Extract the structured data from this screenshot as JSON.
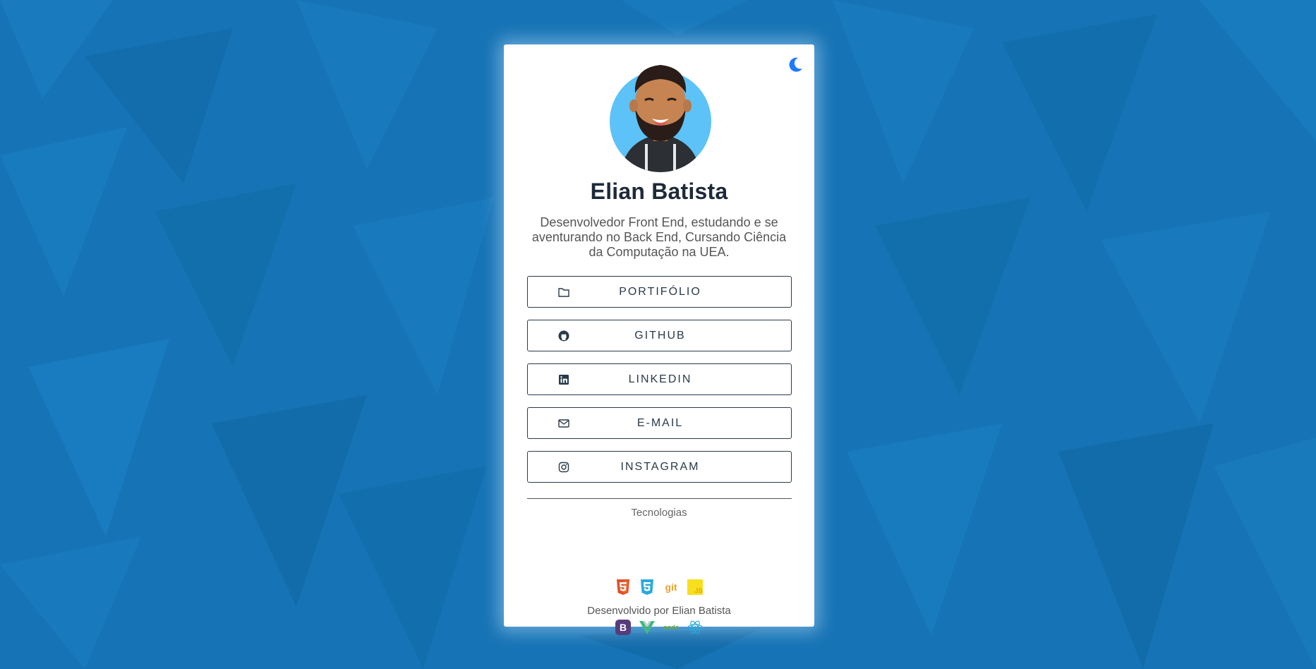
{
  "profile": {
    "name": "Elian Batista",
    "bio": "Desenvolvedor Front End, estudando e se aventurando no Back End, Cursando Ciência da Computação na UEA."
  },
  "theme_toggle": {
    "icon": "moon-icon",
    "color": "#1e7bff"
  },
  "links": [
    {
      "label": "PORTIFÓLIO",
      "icon": "folder-icon"
    },
    {
      "label": "GITHUB",
      "icon": "github-icon"
    },
    {
      "label": "LINKEDIN",
      "icon": "linkedin-icon"
    },
    {
      "label": "E-MAIL",
      "icon": "envelope-icon"
    },
    {
      "label": "INSTAGRAM",
      "icon": "instagram-icon"
    }
  ],
  "tech": {
    "title": "Tecnologias",
    "row1": [
      {
        "icon": "html5-icon",
        "color": "#e34f26"
      },
      {
        "icon": "css3-icon",
        "color": "#29a9df"
      },
      {
        "icon": "git-icon",
        "color": "#f1a02c",
        "text": "git"
      },
      {
        "icon": "javascript-icon",
        "color": "#f7df1e",
        "text": "JS"
      }
    ],
    "row2": [
      {
        "icon": "bootstrap-icon",
        "color": "#563d7c",
        "text": "B"
      },
      {
        "icon": "vue-icon",
        "color": "#42b883"
      },
      {
        "icon": "node-icon",
        "color": "#6aa84f",
        "text": "node"
      },
      {
        "icon": "react-icon",
        "color": "#29a9df"
      }
    ]
  },
  "footer": "Desenvolvido por Elian Batista",
  "colors": {
    "background": "#1673b5",
    "card": "#ffffff",
    "text_dark": "#1e2a3a"
  }
}
